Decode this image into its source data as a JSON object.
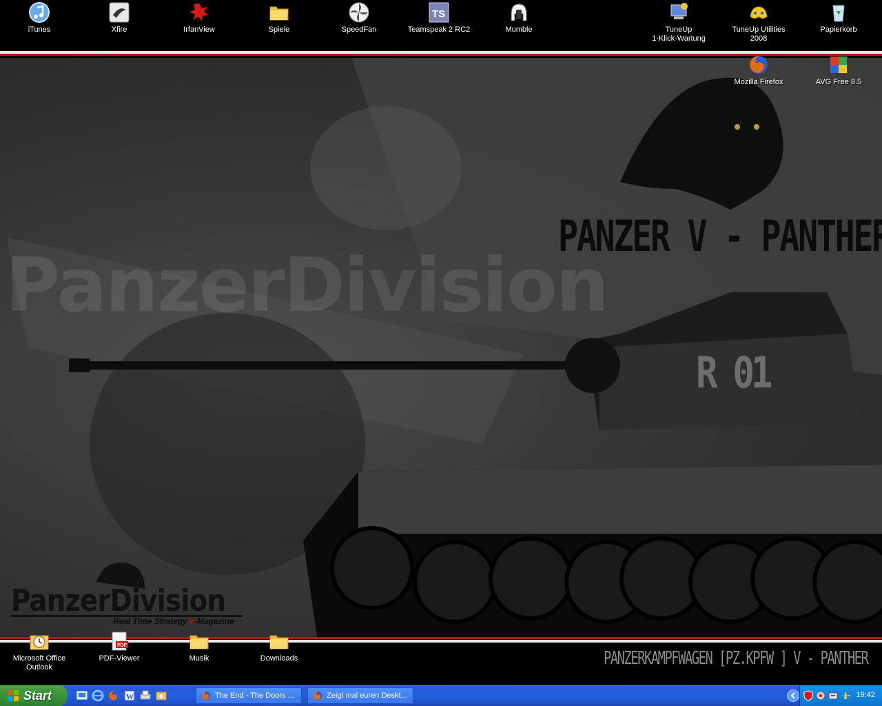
{
  "desktop": {
    "top_icons": [
      {
        "label": "iTunes"
      },
      {
        "label": "Xfire"
      },
      {
        "label": "IrfanView"
      },
      {
        "label": "Spiele"
      },
      {
        "label": "SpeedFan"
      },
      {
        "label": "Teamspeak 2 RC2"
      },
      {
        "label": "Mumble"
      },
      {
        "label": "TuneUp\n1-Klick-Wartung"
      },
      {
        "label": "TuneUp Utilities 2008"
      },
      {
        "label": "Papierkorb"
      },
      {
        "label": "Mozilla Firefox"
      },
      {
        "label": "AVG Free 8.5"
      }
    ],
    "bottom_icons": [
      {
        "label": "Microsoft Office Outlook"
      },
      {
        "label": "PDF-Viewer"
      },
      {
        "label": "Musik"
      },
      {
        "label": "Downloads"
      }
    ]
  },
  "wallpaper": {
    "watermark": "PanzerDivision",
    "title": "PANZER V - PANTHER",
    "turret_marking": "R 01",
    "logo_title": "PanzerDivision",
    "logo_subtitle_pre": "Real Time Strategy ",
    "logo_subtitle_e": "e",
    "logo_subtitle_post": "-Magazine",
    "caption": "PANZERKAMPFWAGEN [PZ.KPFW ] V - PANTHER"
  },
  "taskbar": {
    "start_label": "Start",
    "tasks": [
      {
        "label": "The End - The Doors ..."
      },
      {
        "label": "Zeigt mal euren Deskt..."
      }
    ],
    "clock": "19:42"
  },
  "colors": {
    "taskbar_blue": "#245edc",
    "start_green": "#3d9c39",
    "tray_blue": "#0f84de",
    "accent_red": "#b01818"
  }
}
